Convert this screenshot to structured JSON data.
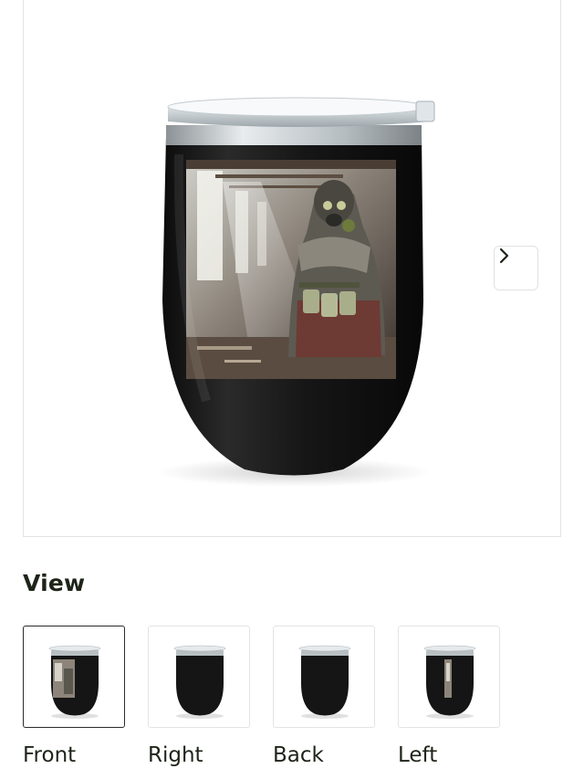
{
  "gallery": {
    "next_icon": "chevron-right-icon",
    "main_view": "Front"
  },
  "view_section": {
    "heading": "View",
    "thumbnails": [
      {
        "label": "Front",
        "selected": true
      },
      {
        "label": "Right",
        "selected": false
      },
      {
        "label": "Back",
        "selected": false
      },
      {
        "label": "Left",
        "selected": false
      }
    ]
  },
  "colors": {
    "heading_text": "#1d2418",
    "tumbler_body": "#141414",
    "lid": "#d8dde0",
    "selected_border": "#2b2b2b"
  }
}
